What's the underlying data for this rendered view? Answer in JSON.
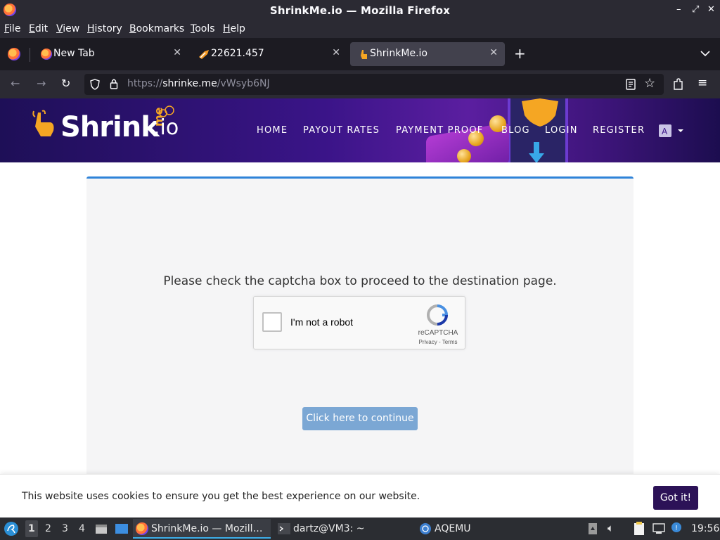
{
  "window": {
    "title": "ShrinkMe.io — Mozilla Firefox",
    "controls": [
      "–",
      "⤢",
      "✕"
    ]
  },
  "menu": [
    "File",
    "Edit",
    "View",
    "History",
    "Bookmarks",
    "Tools",
    "Help"
  ],
  "tabs": [
    {
      "label": "New Tab",
      "icon": "firefox-icon",
      "active": false
    },
    {
      "label": "22621.457",
      "icon": "uup-icon",
      "active": false
    },
    {
      "label": "ShrinkMe.io",
      "icon": "shrinkme-hand-icon",
      "active": true
    }
  ],
  "new_tab_symbol": "+",
  "url": {
    "scheme": "https://",
    "host": "shrinke.me",
    "path": "/vWsyb6NJ"
  },
  "site": {
    "logo": {
      "main": "Shrink",
      "me": "me",
      "tld": ".io"
    },
    "nav": [
      "HOME",
      "PAYOUT RATES",
      "PAYMENT PROOF",
      "BLOG",
      "LOGIN",
      "REGISTER"
    ],
    "prompt": "Please check the captcha box to proceed to the destination page.",
    "recaptcha": {
      "label": "I'm not a robot",
      "brand": "reCAPTCHA",
      "links": "Privacy - Terms"
    },
    "continue_label": "Click here to continue",
    "cookie_text": "This website uses cookies to ensure you get the best experience on our website.",
    "cookie_button": "Got it!"
  },
  "taskbar": {
    "workspaces": [
      "1",
      "2",
      "3",
      "4"
    ],
    "tasks": [
      {
        "label": "ShrinkMe.io — Mozill…",
        "icon": "firefox-icon",
        "active": true
      },
      {
        "label": "dartz@VM3: ~",
        "icon": "terminal-icon",
        "active": false
      },
      {
        "label": "AQEMU",
        "icon": "aqemu-icon",
        "active": false
      }
    ],
    "clock": "19:56"
  },
  "colors": {
    "accent": "#2f83d8",
    "button": "#7ba7d4",
    "cookie_button": "#2c1257",
    "header": "#3a1488"
  }
}
